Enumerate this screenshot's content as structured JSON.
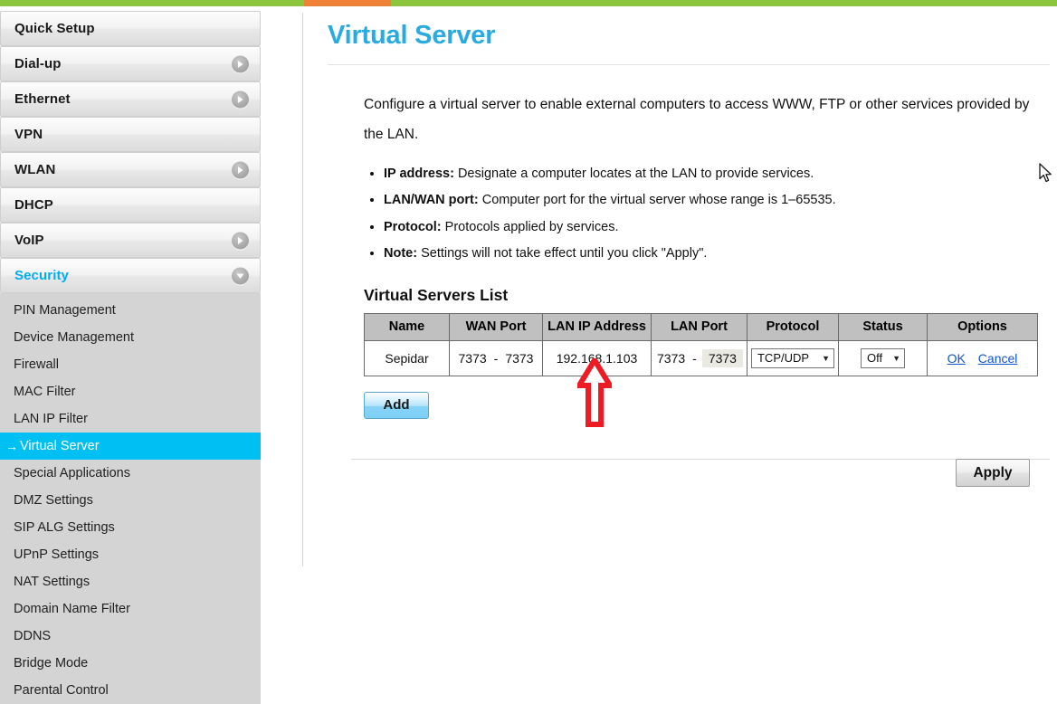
{
  "topbar": {
    "base_color": "#8CC63E",
    "accent_color": "#EF8137"
  },
  "sidebar": {
    "groups": [
      {
        "label": "Quick Setup",
        "icon": "none",
        "active": false
      },
      {
        "label": "Dial-up",
        "icon": "chevron-right-icon",
        "active": false
      },
      {
        "label": "Ethernet",
        "icon": "chevron-right-icon",
        "active": false
      },
      {
        "label": "VPN",
        "icon": "none",
        "active": false
      },
      {
        "label": "WLAN",
        "icon": "chevron-right-icon",
        "active": false
      },
      {
        "label": "DHCP",
        "icon": "none",
        "active": false
      },
      {
        "label": "VoIP",
        "icon": "chevron-right-icon",
        "active": false
      },
      {
        "label": "Security",
        "icon": "chevron-down-icon",
        "active": true
      }
    ],
    "security_items": [
      {
        "label": "PIN Management",
        "selected": false
      },
      {
        "label": "Device Management",
        "selected": false
      },
      {
        "label": "Firewall",
        "selected": false
      },
      {
        "label": "MAC Filter",
        "selected": false
      },
      {
        "label": "LAN IP Filter",
        "selected": false
      },
      {
        "label": "Virtual Server",
        "selected": true
      },
      {
        "label": "Special Applications",
        "selected": false
      },
      {
        "label": "DMZ Settings",
        "selected": false
      },
      {
        "label": "SIP ALG Settings",
        "selected": false
      },
      {
        "label": "UPnP Settings",
        "selected": false
      },
      {
        "label": "NAT Settings",
        "selected": false
      },
      {
        "label": "Domain Name Filter",
        "selected": false
      },
      {
        "label": "DDNS",
        "selected": false
      },
      {
        "label": "Bridge Mode",
        "selected": false
      },
      {
        "label": "Parental Control",
        "selected": false
      }
    ],
    "selected_marker": "→",
    "accent_color": "#00BFF3"
  },
  "main": {
    "title": "Virtual Server",
    "title_color": "#29ABE2",
    "intro": "Configure a virtual server to enable external computers to access WWW, FTP or other services provided by the LAN.",
    "bullets": [
      {
        "term": "IP address:",
        "text": "Designate a computer locates at the LAN to provide services."
      },
      {
        "term": "LAN/WAN port:",
        "text": "Computer port for the virtual server whose range is 1–65535."
      },
      {
        "term": "Protocol:",
        "text": "Protocols applied by services."
      },
      {
        "term": "Note:",
        "text": "Settings will not take effect until you click \"Apply\"."
      }
    ],
    "section_title": "Virtual Servers List",
    "table": {
      "headers": [
        "Name",
        "WAN Port",
        "LAN IP Address",
        "LAN Port",
        "Protocol",
        "Status",
        "Options"
      ],
      "rows": [
        {
          "name": "Sepidar",
          "wan_port_start": "7373",
          "wan_port_end": "7373",
          "port_separator": "-",
          "lan_ip": "192.168.1.103",
          "lan_port_start": "7373",
          "lan_port_end": "7373",
          "protocol": "TCP/UDP",
          "status": "Off",
          "option_ok": "OK",
          "option_cancel": "Cancel"
        }
      ]
    },
    "add_label": "Add",
    "apply_label": "Apply"
  },
  "annotation": {
    "arrow_color": "#ED1C24",
    "arrow_direction": "up"
  }
}
